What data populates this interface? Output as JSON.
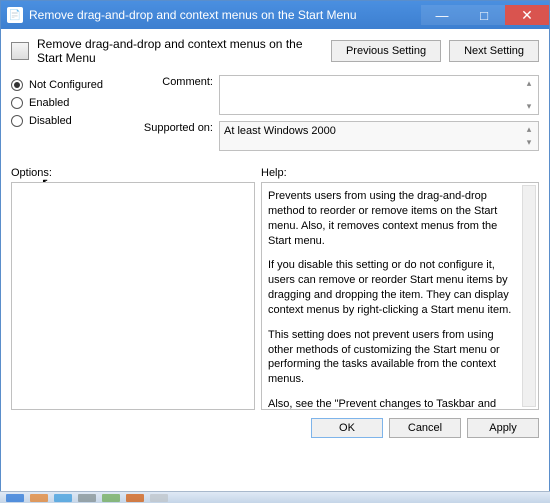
{
  "titlebar": {
    "title": "Remove drag-and-drop and context menus on the Start Menu"
  },
  "header": {
    "label": "Remove drag-and-drop and context menus on the Start Menu",
    "prev": "Previous Setting",
    "next": "Next Setting"
  },
  "radios": {
    "not_configured": "Not Configured",
    "enabled": "Enabled",
    "disabled": "Disabled",
    "selected": "not_configured"
  },
  "fields": {
    "comment_label": "Comment:",
    "comment_value": "",
    "supported_label": "Supported on:",
    "supported_value": "At least Windows 2000"
  },
  "sections": {
    "options": "Options:",
    "help": "Help:"
  },
  "help": {
    "p1": "Prevents users from using the drag-and-drop method to reorder or remove items on the Start menu. Also, it removes context menus from the Start menu.",
    "p2": "If you disable this setting or do not configure it, users can remove or reorder Start menu items by dragging and dropping the item. They can display context menus by right-clicking a Start menu item.",
    "p3": "This setting does not prevent users from using other methods of customizing the Start menu or performing the tasks available from the context menus.",
    "p4": "Also, see the \"Prevent changes to Taskbar and Start Menu Settings\" and the \"Remove access to the context menus for taskbar\" settings."
  },
  "footer": {
    "ok": "OK",
    "cancel": "Cancel",
    "apply": "Apply"
  }
}
